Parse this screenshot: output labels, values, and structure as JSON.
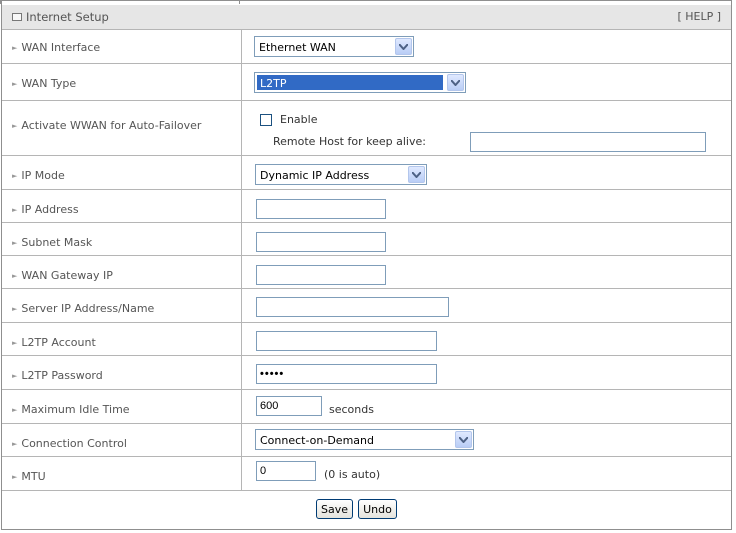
{
  "header": {
    "title": "Internet Setup",
    "help": "[ HELP ]"
  },
  "rows": {
    "wan_interface": {
      "label": "WAN Interface",
      "value": "Ethernet WAN"
    },
    "wan_type": {
      "label": "WAN Type",
      "value": "L2TP"
    },
    "wwan_failover": {
      "label": "Activate WWAN for Auto-Failover",
      "checkbox_label": "Enable",
      "remote_host_label": "Remote Host for keep alive:",
      "remote_host_value": ""
    },
    "ip_mode": {
      "label": "IP Mode",
      "value": "Dynamic IP Address"
    },
    "ip_address": {
      "label": "IP Address",
      "value": ""
    },
    "subnet_mask": {
      "label": "Subnet Mask",
      "value": ""
    },
    "wan_gateway": {
      "label": "WAN Gateway IP",
      "value": ""
    },
    "server_ip": {
      "label": "Server IP Address/Name",
      "value": ""
    },
    "l2tp_account": {
      "label": "L2TP Account",
      "value": ""
    },
    "l2tp_password": {
      "label": "L2TP Password",
      "value": "•••••"
    },
    "max_idle": {
      "label": "Maximum Idle Time",
      "value": "600",
      "unit": "seconds"
    },
    "connection_control": {
      "label": "Connection Control",
      "value": "Connect-on-Demand"
    },
    "mtu": {
      "label": "MTU",
      "value": "0",
      "hint": "(0 is auto)"
    }
  },
  "buttons": {
    "save": "Save",
    "undo": "Undo"
  }
}
